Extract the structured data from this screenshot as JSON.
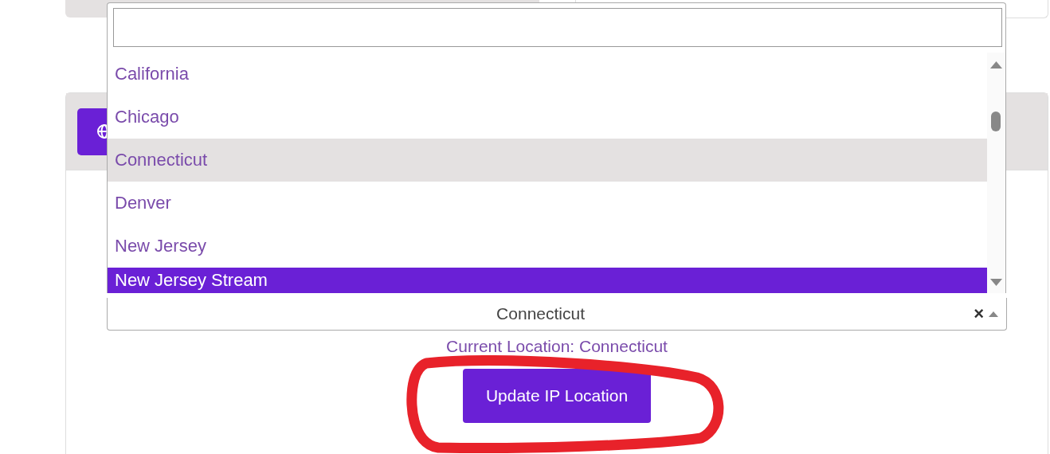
{
  "dropdown": {
    "options": [
      {
        "label": "California",
        "selected": false,
        "highlighted": false
      },
      {
        "label": "Chicago",
        "selected": false,
        "highlighted": false
      },
      {
        "label": "Connecticut",
        "selected": true,
        "highlighted": false
      },
      {
        "label": "Denver",
        "selected": false,
        "highlighted": false
      },
      {
        "label": "New Jersey",
        "selected": false,
        "highlighted": false
      },
      {
        "label": "New Jersey Stream",
        "selected": false,
        "highlighted": true
      }
    ]
  },
  "location_select": {
    "value": "Connecticut",
    "clear": "×"
  },
  "current_location": "Current Location: Connecticut",
  "update_button": "Update IP Location"
}
